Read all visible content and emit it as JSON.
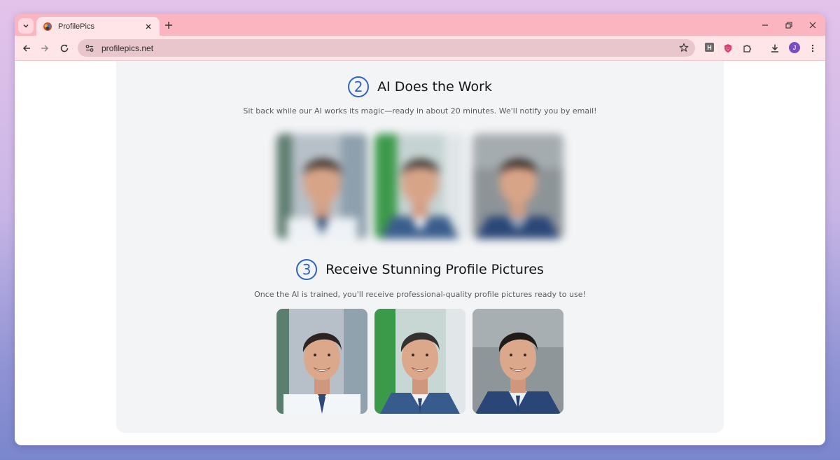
{
  "browser": {
    "tab_title": "ProfilePics",
    "url": "profilepics.net",
    "avatar_initial": "J",
    "extension_letter": "H"
  },
  "steps": [
    {
      "number": "2",
      "title": "AI Does the Work",
      "description": "Sit back while our AI works its magic—ready in about 20 minutes. We'll notify you by email!",
      "images_blurred": true
    },
    {
      "number": "3",
      "title": "Receive Stunning Profile Pictures",
      "description": "Once the AI is trained, you'll receive professional-quality profile pictures ready to use!",
      "images_blurred": false
    }
  ],
  "photos": [
    {
      "background": "grey-window",
      "outfit": "white-shirt-tie"
    },
    {
      "background": "green-office",
      "outfit": "blue-suit"
    },
    {
      "background": "grey-studio",
      "outfit": "blue-suit-tie"
    }
  ],
  "colors": {
    "tab_strip": "#fbb5c0",
    "toolbar": "#ffe4e8",
    "accent": "#2d63c8",
    "section_bg": "#f3f4f6"
  }
}
